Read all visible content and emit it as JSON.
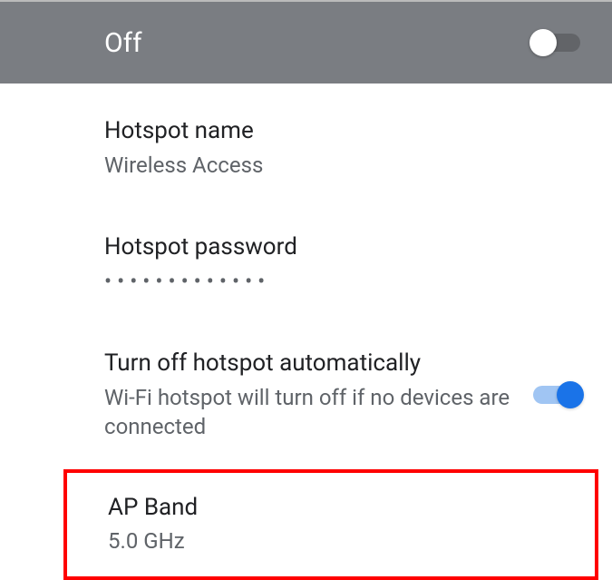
{
  "header": {
    "status_label": "Off"
  },
  "settings": {
    "hotspot_name": {
      "title": "Hotspot name",
      "value": "Wireless Access"
    },
    "hotspot_password": {
      "title": "Hotspot password",
      "masked_value": "•••••••••••••"
    },
    "auto_off": {
      "title": "Turn off hotspot automatically",
      "subtitle": "Wi-Fi hotspot will turn off if no devices are connected"
    },
    "ap_band": {
      "title": "AP Band",
      "value": "5.0 GHz"
    }
  }
}
